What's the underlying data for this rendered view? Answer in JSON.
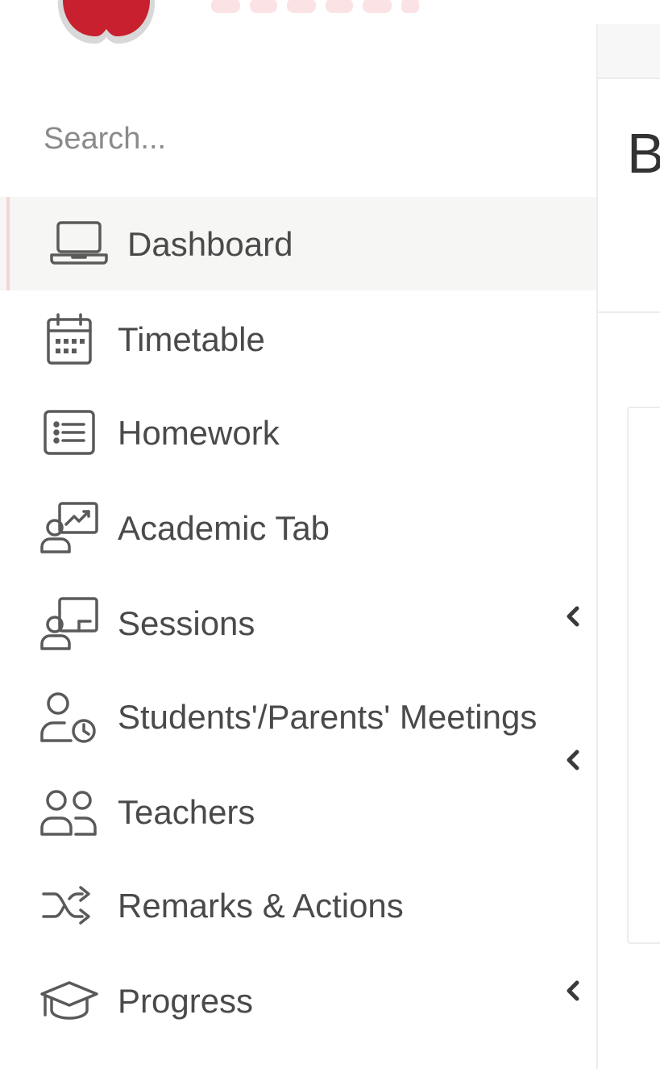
{
  "sidebar": {
    "search": {
      "placeholder": "Search...",
      "value": ""
    },
    "items": [
      {
        "label": "Dashboard",
        "icon": "laptop-icon",
        "active": true,
        "has_submenu": false
      },
      {
        "label": "Timetable",
        "icon": "calendar-icon",
        "active": false,
        "has_submenu": false
      },
      {
        "label": "Homework",
        "icon": "list-icon",
        "active": false,
        "has_submenu": false
      },
      {
        "label": "Academic Tab",
        "icon": "presentation-chart-icon",
        "active": false,
        "has_submenu": false
      },
      {
        "label": "Sessions",
        "icon": "classroom-icon",
        "active": false,
        "has_submenu": true
      },
      {
        "label": "Students'/Parents' Meetings",
        "icon": "user-clock-icon",
        "active": false,
        "has_submenu": true
      },
      {
        "label": "Teachers",
        "icon": "users-icon",
        "active": false,
        "has_submenu": false
      },
      {
        "label": "Remarks & Actions",
        "icon": "shuffle-icon",
        "active": false,
        "has_submenu": false
      },
      {
        "label": "Progress",
        "icon": "graduation-cap-icon",
        "active": false,
        "has_submenu": true
      }
    ]
  },
  "main": {
    "heading": "B"
  },
  "colors": {
    "brand": "#c8202e",
    "active_background": "#f6f6f4",
    "active_indicator": "#f4d5d8",
    "text": "#4a4a4a",
    "placeholder": "#8a8a8a"
  }
}
